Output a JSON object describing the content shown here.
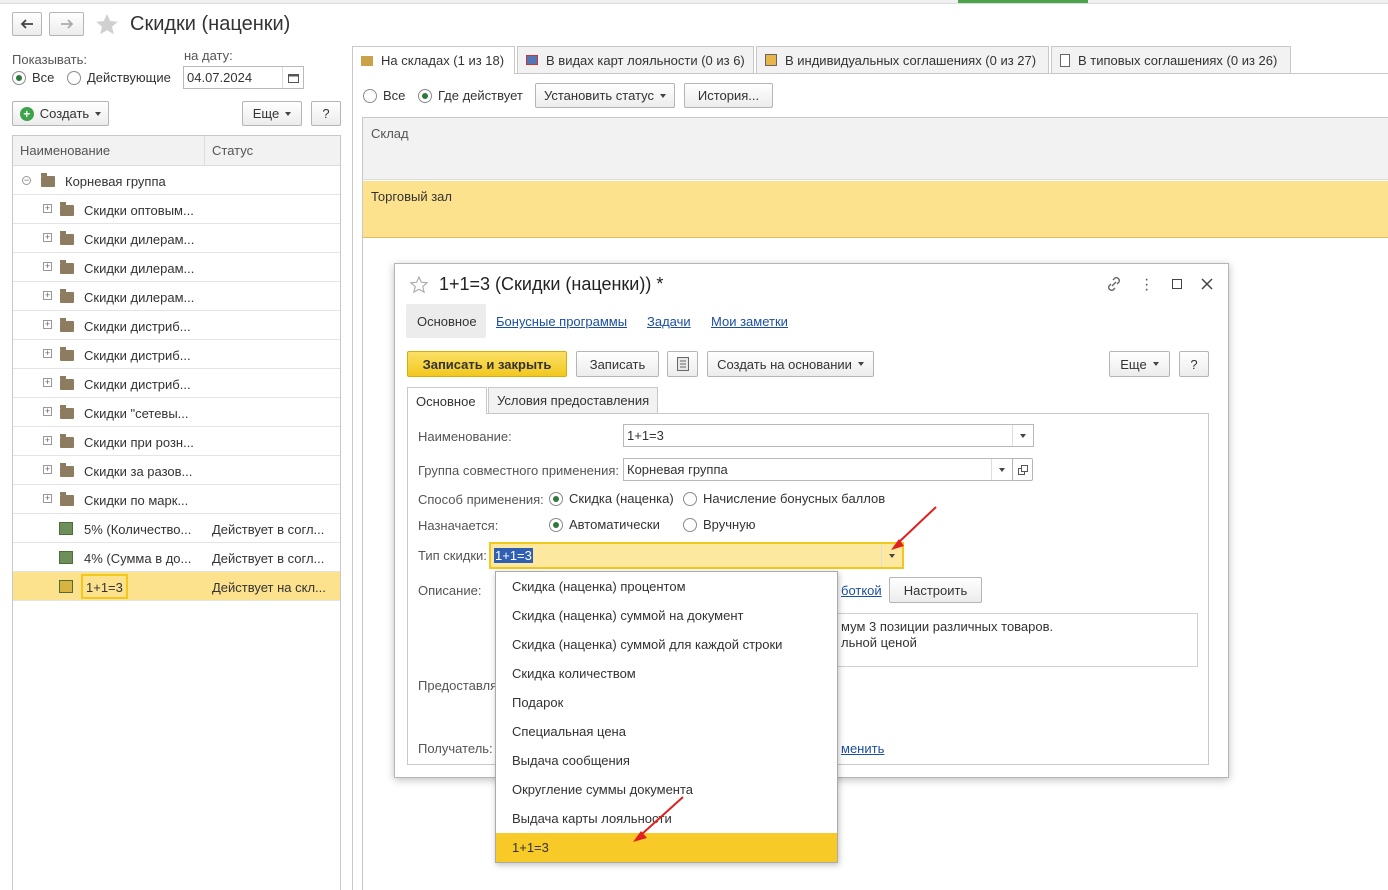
{
  "window": {
    "title": "Скидки (наценки)",
    "back_icon": "arrow-left-icon",
    "forward_icon": "arrow-right-icon",
    "favorite_icon": "star-icon"
  },
  "filter": {
    "show_label": "Показывать:",
    "options": [
      "Все",
      "Действующие"
    ],
    "selected": "Все",
    "date_label": "на дату:",
    "date_value": "04.07.2024"
  },
  "toolbar_left": {
    "create_label": "Создать",
    "more_label": "Еще",
    "help_label": "?"
  },
  "list": {
    "columns": [
      "Наименование",
      "Статус"
    ],
    "root": "Корневая группа",
    "rows": [
      {
        "name": "Скидки оптовым...",
        "status": "",
        "kind": "folder-group"
      },
      {
        "name": "Скидки дилерам...",
        "status": "",
        "kind": "folder-group"
      },
      {
        "name": "Скидки дилерам...",
        "status": "",
        "kind": "folder-group"
      },
      {
        "name": "Скидки дилерам...",
        "status": "",
        "kind": "folder-group"
      },
      {
        "name": "Скидки дистриб...",
        "status": "",
        "kind": "folder-group"
      },
      {
        "name": "Скидки дистриб...",
        "status": "",
        "kind": "folder-group"
      },
      {
        "name": "Скидки дистриб...",
        "status": "",
        "kind": "folder-group"
      },
      {
        "name": "Скидки \"сетевы...",
        "status": "",
        "kind": "folder"
      },
      {
        "name": "Скидки при розн...",
        "status": "",
        "kind": "folder"
      },
      {
        "name": "Скидки за разов...",
        "status": "",
        "kind": "folder"
      },
      {
        "name": "Скидки по марк...",
        "status": "",
        "kind": "folder"
      },
      {
        "name": "5% (Количество...",
        "status": "Действует в согл...",
        "kind": "item"
      },
      {
        "name": "4% (Сумма в до...",
        "status": "Действует в согл...",
        "kind": "item"
      },
      {
        "name": "1+1=3",
        "status": "Действует на скл...",
        "kind": "item-selected"
      }
    ]
  },
  "tabs": [
    {
      "label": "На складах (1 из 18)",
      "icon": "warehouse-icon"
    },
    {
      "label": "В видах карт лояльности (0 из 6)",
      "icon": "card-icon"
    },
    {
      "label": "В индивидуальных соглашениях (0 из 27)",
      "icon": "person-doc-icon"
    },
    {
      "label": "В типовых соглашениях (0 из 26)",
      "icon": "document-icon"
    }
  ],
  "right_filter": {
    "options": [
      "Все",
      "Где действует"
    ],
    "selected": "Где действует",
    "set_status_label": "Установить статус",
    "history_label": "История..."
  },
  "warehouse_table": {
    "header": "Склад",
    "row": "Торговый зал"
  },
  "dialog": {
    "title": "1+1=3 (Скидки (наценки)) *",
    "nav": [
      "Основное",
      "Бонусные программы",
      "Задачи",
      "Мои заметки"
    ],
    "save_close_label": "Записать и закрыть",
    "save_label": "Записать",
    "create_based_label": "Создать на основании",
    "more_label": "Еще",
    "help_label": "?",
    "inner_tabs": [
      "Основное",
      "Условия предоставления"
    ],
    "name_label": "Наименование:",
    "name_value": "1+1=3",
    "group_label": "Группа совместного применения:",
    "group_value": "Корневая группа",
    "method_label": "Способ применения:",
    "method_options": [
      "Скидка (наценка)",
      "Начисление бонусных баллов"
    ],
    "method_selected": "Скидка (наценка)",
    "assigned_label": "Назначается:",
    "assigned_options": [
      "Автоматически",
      "Вручную"
    ],
    "assigned_selected": "Автоматически",
    "type_label": "Тип скидки:",
    "type_value": "1+1=3",
    "description_label": "Описание:",
    "description_link_tail": "боткой",
    "configure_label": "Настроить",
    "description_text_line1": "мум 3 позиции различных товаров.",
    "description_text_line2": "льной ценой",
    "provided_label": "Предоставля",
    "recipient_label": "Получатель:",
    "recipient_link_tail": "менить"
  },
  "dropdown": {
    "items": [
      "Скидка (наценка) процентом",
      "Скидка (наценка) суммой на документ",
      "Скидка (наценка) суммой для каждой строки",
      "Скидка количеством",
      "Подарок",
      "Специальная цена",
      "Выдача сообщения",
      "Округление суммы документа",
      "Выдача карты лояльности",
      "1+1=3"
    ],
    "selected": "1+1=3"
  },
  "colors": {
    "accent_yellow": "#f9d84a",
    "highlight_row": "#fde28e",
    "selected_menu": "#f8ca28",
    "arrow_red": "#e02020",
    "link_blue": "#1c4fa0"
  }
}
